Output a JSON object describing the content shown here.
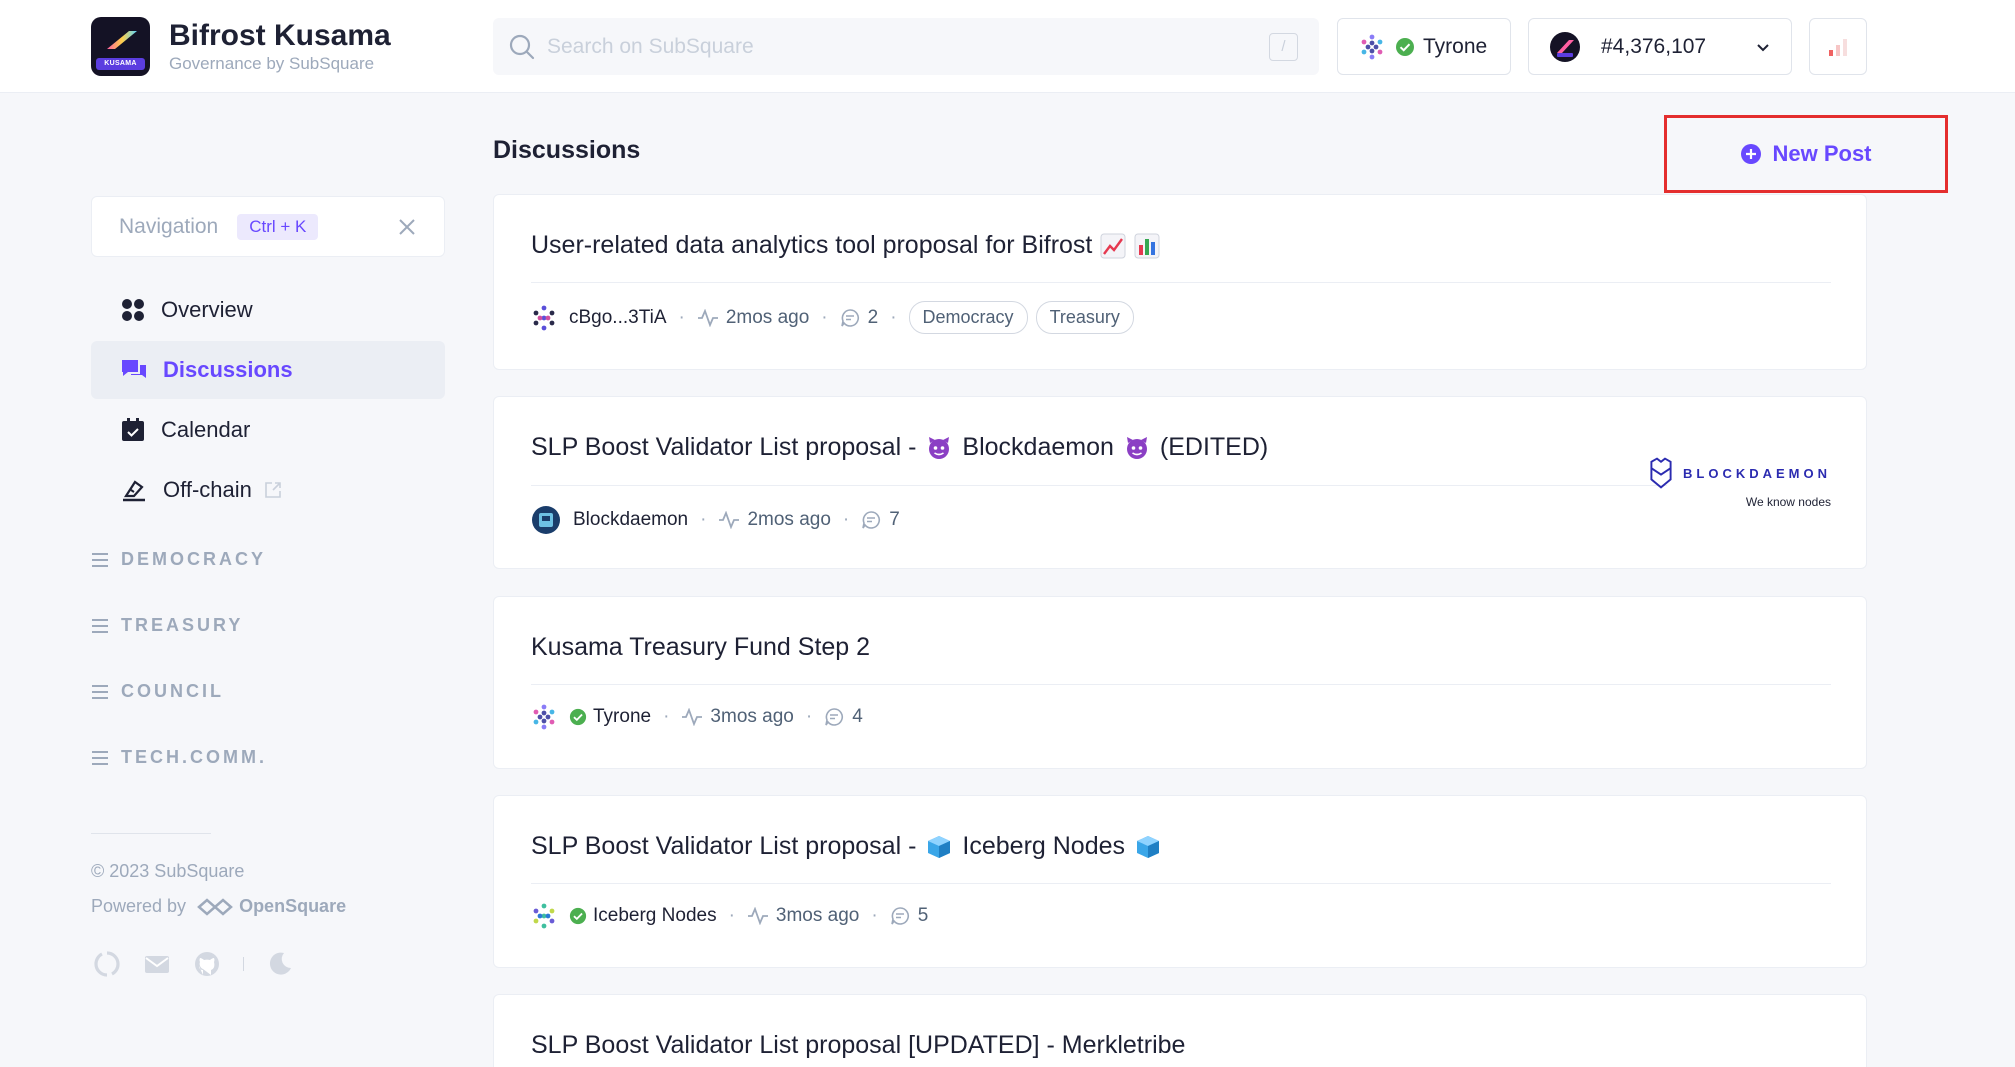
{
  "brand": {
    "title": "Bifrost Kusama",
    "subtitle": "Governance by SubSquare",
    "logo_badge": "KUSAMA"
  },
  "search": {
    "placeholder": "Search on SubSquare",
    "shortcut": "/"
  },
  "account": {
    "name": "Tyrone"
  },
  "block": {
    "number": "#4,376,107"
  },
  "navigation": {
    "label": "Navigation",
    "shortcut": "Ctrl + K"
  },
  "menu": [
    {
      "label": "Overview",
      "icon": "grid-icon"
    },
    {
      "label": "Discussions",
      "icon": "chat-icon",
      "active": true
    },
    {
      "label": "Calendar",
      "icon": "calendar-icon"
    },
    {
      "label": "Off-chain",
      "icon": "vote-icon",
      "external": true
    }
  ],
  "sections": [
    "DEMOCRACY",
    "TREASURY",
    "COUNCIL",
    "TECH.COMM."
  ],
  "footer": {
    "copyright": "© 2023 SubSquare",
    "powered_by": "Powered by",
    "powered_name": "OpenSquare"
  },
  "page": {
    "title": "Discussions",
    "new_post": "New Post"
  },
  "posts": [
    {
      "title": "User-related data analytics tool proposal for Bifrost",
      "emojis": [
        "chart-increasing-emoji",
        "bar-chart-emoji"
      ],
      "author": "cBgo...3TiA",
      "time": "2mos ago",
      "comments": "2",
      "tags": [
        "Democracy",
        "Treasury"
      ]
    },
    {
      "title_prefix": "SLP Boost Validator List proposal -",
      "title_mid": "Blockdaemon",
      "title_suffix": "(EDITED)",
      "author": "Blockdaemon",
      "time": "2mos ago",
      "comments": "7",
      "banner_text": "BLOCKDAEMON",
      "banner_sub": "We know nodes"
    },
    {
      "title": "Kusama Treasury Fund Step 2",
      "author": "Tyrone",
      "time": "3mos ago",
      "comments": "4"
    },
    {
      "title_prefix": "SLP Boost Validator List proposal -",
      "title_mid": "Iceberg Nodes",
      "author": "Iceberg Nodes",
      "time": "3mos ago",
      "comments": "5"
    },
    {
      "title": "SLP Boost Validator List proposal [UPDATED] - Merkletribe"
    }
  ],
  "colors": {
    "accent": "#6848ff",
    "highlight_box": "#e42e2e",
    "verified": "#4caf50"
  }
}
